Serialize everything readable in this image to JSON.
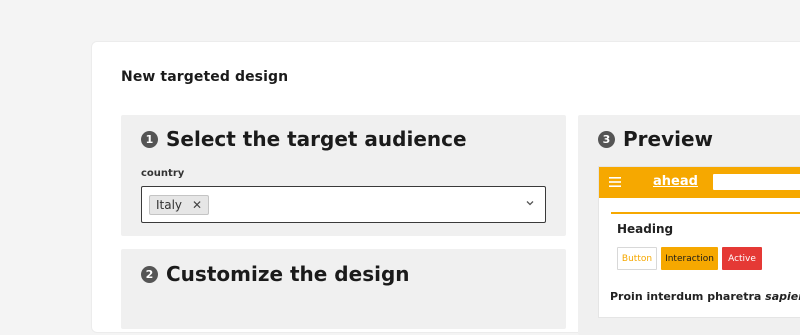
{
  "card": {
    "title": "New targeted design"
  },
  "audience": {
    "step": "1",
    "heading": "Select the target audience",
    "field_label": "country",
    "selected_chip": "Italy",
    "chip_remove": "✕"
  },
  "customize": {
    "step": "2",
    "heading": "Customize the design"
  },
  "preview": {
    "step": "3",
    "heading": "Preview",
    "logo": "ahead",
    "section_heading": "Heading",
    "buttons": [
      "Button",
      "Interaction",
      "Active"
    ],
    "body_text_bold": "Proin interdum pharetra ",
    "body_text_italic": "sapien,"
  },
  "colors": {
    "accent": "#f6a800",
    "danger": "#e53935",
    "panel_bg": "#f0f0f0",
    "page_bg": "#f4f4f4"
  }
}
